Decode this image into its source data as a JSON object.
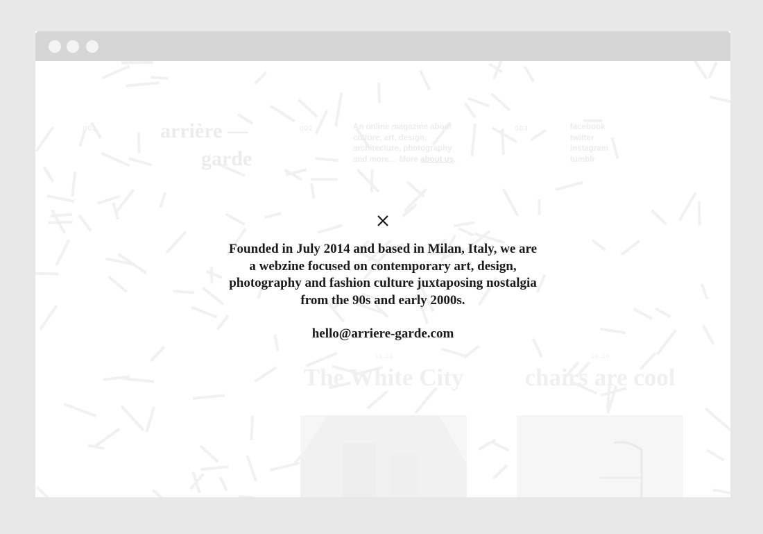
{
  "site": {
    "nav": {
      "logo_num": "001",
      "logo_line1": "arrière —",
      "logo_line2": "garde",
      "about_num": "002",
      "about_text": "An online magazine about culture, art, design, architecture, photography and more… More ",
      "about_link": "about us",
      "about_suffix": ".",
      "social_num": "003",
      "social_links": [
        "facebook",
        "twitter",
        "instagram",
        "tumblr"
      ]
    },
    "cards": [
      {
        "date": "31.12",
        "title": "The White City"
      },
      {
        "date": "18.10",
        "title": "chairs are cool"
      }
    ]
  },
  "modal": {
    "close_icon": "close-icon",
    "description": "Founded in July 2014 and based in Milan, Italy, we are a webzine focused on contemporary art, design, photography and fashion culture juxtaposing nostalgia from the 90s and early 2000s.",
    "email": "hello@arriere-garde.com"
  },
  "colors": {
    "background": "#ffffff",
    "text": "#1a1a1a",
    "frame": "#e8e8e8",
    "titlebar": "#d6d6d6"
  }
}
